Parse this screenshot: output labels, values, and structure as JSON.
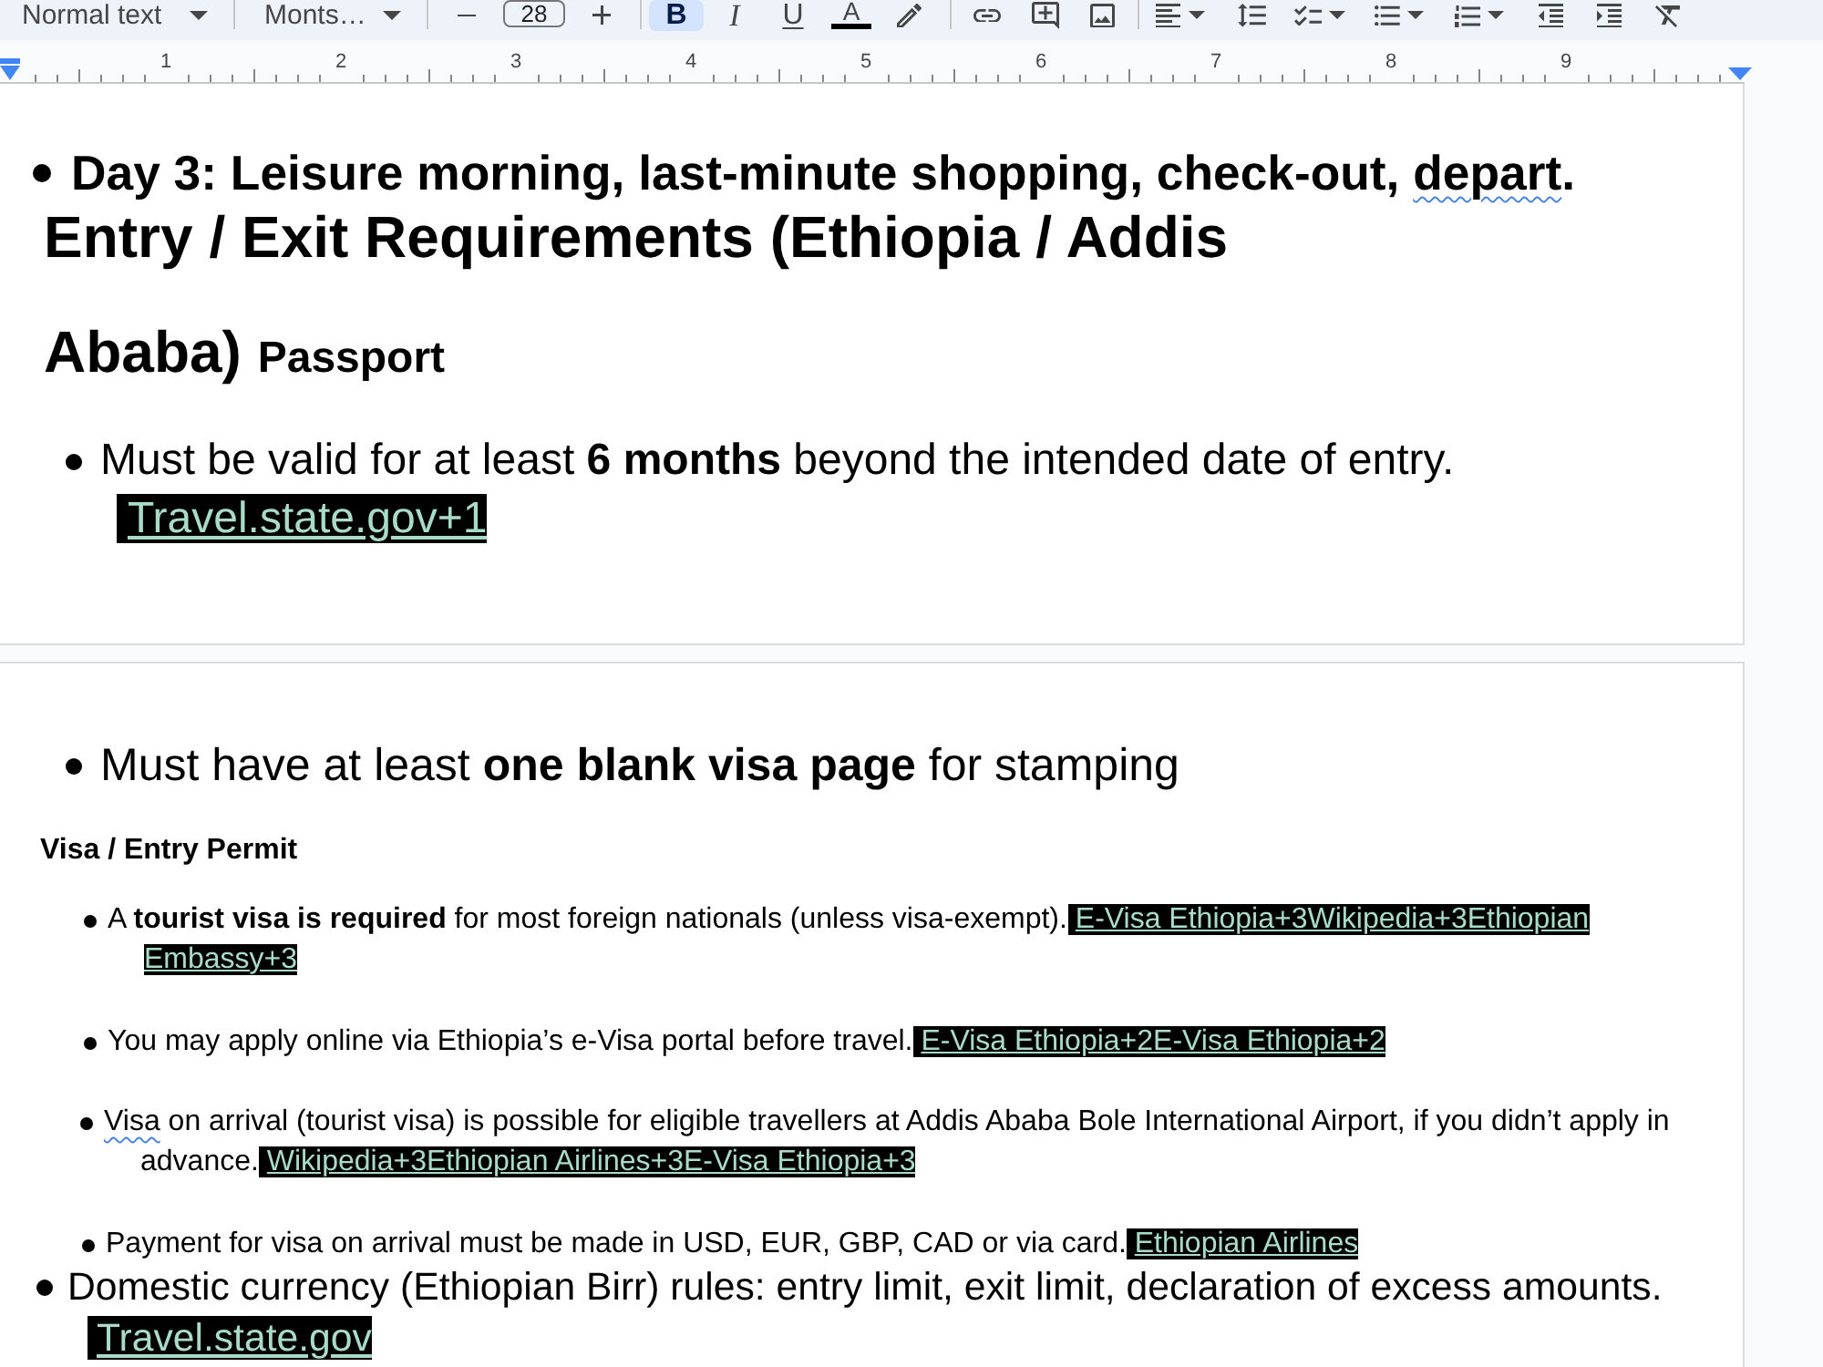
{
  "toolbar": {
    "groups": [
      [
        {
          "kind": "style-dropdown",
          "label": "Normal text"
        }
      ],
      [
        {
          "kind": "font-dropdown",
          "label": "Monts…"
        }
      ],
      [
        {
          "kind": "minus"
        },
        {
          "kind": "size-field",
          "value": "28"
        },
        {
          "kind": "plus"
        }
      ],
      [
        {
          "kind": "bold",
          "label": "B",
          "active": true
        },
        {
          "kind": "italic",
          "label": "I",
          "active": false
        },
        {
          "kind": "underline",
          "label": "U",
          "active": false
        },
        {
          "kind": "text-color",
          "label": "A",
          "active": false
        },
        {
          "kind": "highlight",
          "active": false
        }
      ],
      [
        {
          "kind": "link"
        },
        {
          "kind": "comment"
        },
        {
          "kind": "image"
        }
      ],
      [
        {
          "kind": "align"
        },
        {
          "kind": "line-spacing"
        },
        {
          "kind": "checklist"
        },
        {
          "kind": "bullets"
        },
        {
          "kind": "numbered"
        },
        {
          "kind": "indent-less"
        },
        {
          "kind": "indent-more"
        },
        {
          "kind": "clear-format"
        }
      ]
    ]
  },
  "ruler": {
    "labels": [
      "1",
      "2",
      "3",
      "4",
      "5",
      "6",
      "7",
      "8",
      "9"
    ]
  },
  "pages": [
    {
      "blocks": [
        {
          "kind": "list-item",
          "segments": [
            {
              "text": "Day 3: Leisure morning, last-minute shopping, check-out, ",
              "flagged": false
            },
            {
              "text": "depart",
              "flagged": true
            },
            {
              "text": ".",
              "flagged": false
            }
          ]
        },
        {
          "kind": "heading",
          "lines": [
            "Entry / Exit Requirements (Ethiopia / Addis",
            "Ababa)"
          ],
          "subheading": "Passport"
        },
        {
          "kind": "list-item",
          "segments": [
            {
              "text": "Must be valid for at least **6 months** beyond the intended date of entry.",
              "flagged": false
            }
          ],
          "link": {
            "lines": [
              "Travel.state.gov+1"
            ]
          }
        }
      ]
    },
    {
      "blocks": [
        {
          "kind": "list-item",
          "segments": [
            {
              "text": "Must have at least **one blank visa page** for stamping",
              "flagged": false
            }
          ]
        },
        {
          "kind": "subheading",
          "text": "Visa / Entry Permit"
        },
        {
          "kind": "list-item",
          "segments": [
            {
              "text": "A **tourist visa is required** for most foreign nationals (unless visa-exempt).",
              "flagged": false
            }
          ],
          "link": {
            "lines": [
              "E-Visa Ethiopia+3Wikipedia+3Ethiopian",
              "Embassy+3"
            ]
          }
        },
        {
          "kind": "list-item",
          "segments": [
            {
              "text": "You may apply online via Ethiopia’s e-Visa portal before travel.",
              "flagged": false
            }
          ],
          "link": {
            "lines": [
              "E-Visa Ethiopia+2E-Visa Ethiopia+2"
            ]
          }
        },
        {
          "kind": "list-item",
          "segments": [
            {
              "text": "Visa",
              "flagged": true
            },
            {
              "text": " on arrival (tourist visa) is possible for eligible travellers at Addis Ababa Bole International Airport, if you didn’t apply in advance.",
              "flagged": false
            }
          ],
          "link": {
            "lines": [
              "Wikipedia+3Ethiopian Airlines+3E-Visa Ethiopia+3"
            ]
          }
        },
        {
          "kind": "list-item",
          "segments": [
            {
              "text": "Payment for visa on arrival must be made in USD, EUR, GBP, CAD or via card.",
              "flagged": false
            }
          ],
          "link": {
            "lines": [
              "Ethiopian Airlines"
            ]
          }
        },
        {
          "kind": "list-item",
          "segments": [
            {
              "text": "Domestic currency (Ethiopian Birr) rules: entry limit, exit limit, declaration of excess amounts.",
              "flagged": false
            }
          ],
          "link": {
            "lines": [
              "Travel.state.gov"
            ]
          }
        }
      ]
    }
  ]
}
